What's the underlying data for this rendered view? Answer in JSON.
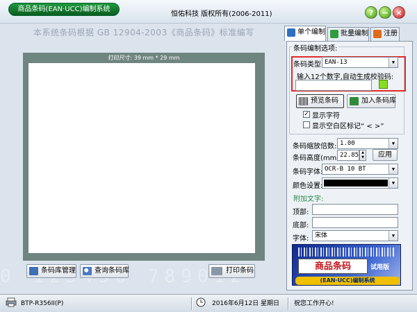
{
  "title_bar": {
    "app_title": "商品条码(EAN·UCC)编制系统",
    "copyright": "恒佑科技 版权所有(2006-2011)",
    "help_glyph": "?",
    "min_glyph": "−",
    "close_glyph": "×"
  },
  "left_panel": {
    "standard_text": "本系统条码根据 GB 12904-2003《商品条码》标准编写",
    "print_size_label": "打印尺寸: 39 mm * 29 mm",
    "watermark": "0 123456 789012",
    "buttons": {
      "manage": "条码库管理",
      "query": "查询条码库",
      "print": "打印条码"
    }
  },
  "tabs": [
    {
      "label": "单个编制"
    },
    {
      "label": "批量编制"
    },
    {
      "label": "注册"
    }
  ],
  "options": {
    "group_title": "条码编制选项:",
    "type_label": "条码类型:",
    "type_value": "EAN-13",
    "input_hint": "输入12个数字,自动生成校验码:",
    "input_value": "",
    "preview_button": "预览条码",
    "add_button": "加入条码库",
    "show_chars_label": "显示字符",
    "show_chars_checked": true,
    "show_blank_label": "显示空白区标记“ < >”",
    "show_blank_checked": false,
    "scale_label": "条码缩放倍数:",
    "scale_value": "1.00",
    "height_label": "条码高度(mm):",
    "height_value": "22.85",
    "apply_button": "应用",
    "font_label": "条码字体:",
    "font_value": "OCR-B 10 BT",
    "color_label": "颜色设置:",
    "color_value": "#000000"
  },
  "extra_text": {
    "title": "附加文字:",
    "top_label": "顶部:",
    "top_value": "",
    "bottom_label": "底部:",
    "bottom_value": "",
    "font_label": "字体:",
    "font_value": "宋体"
  },
  "ad": {
    "title": "商品条码",
    "trial": "试用版",
    "subtitle": "(EAN·UCC)编制系统"
  },
  "status_bar": {
    "printer": "BTP-R356II(P)",
    "date": "2016年6月12日",
    "weekday": "星期日",
    "message": "祝您工作开心!"
  }
}
